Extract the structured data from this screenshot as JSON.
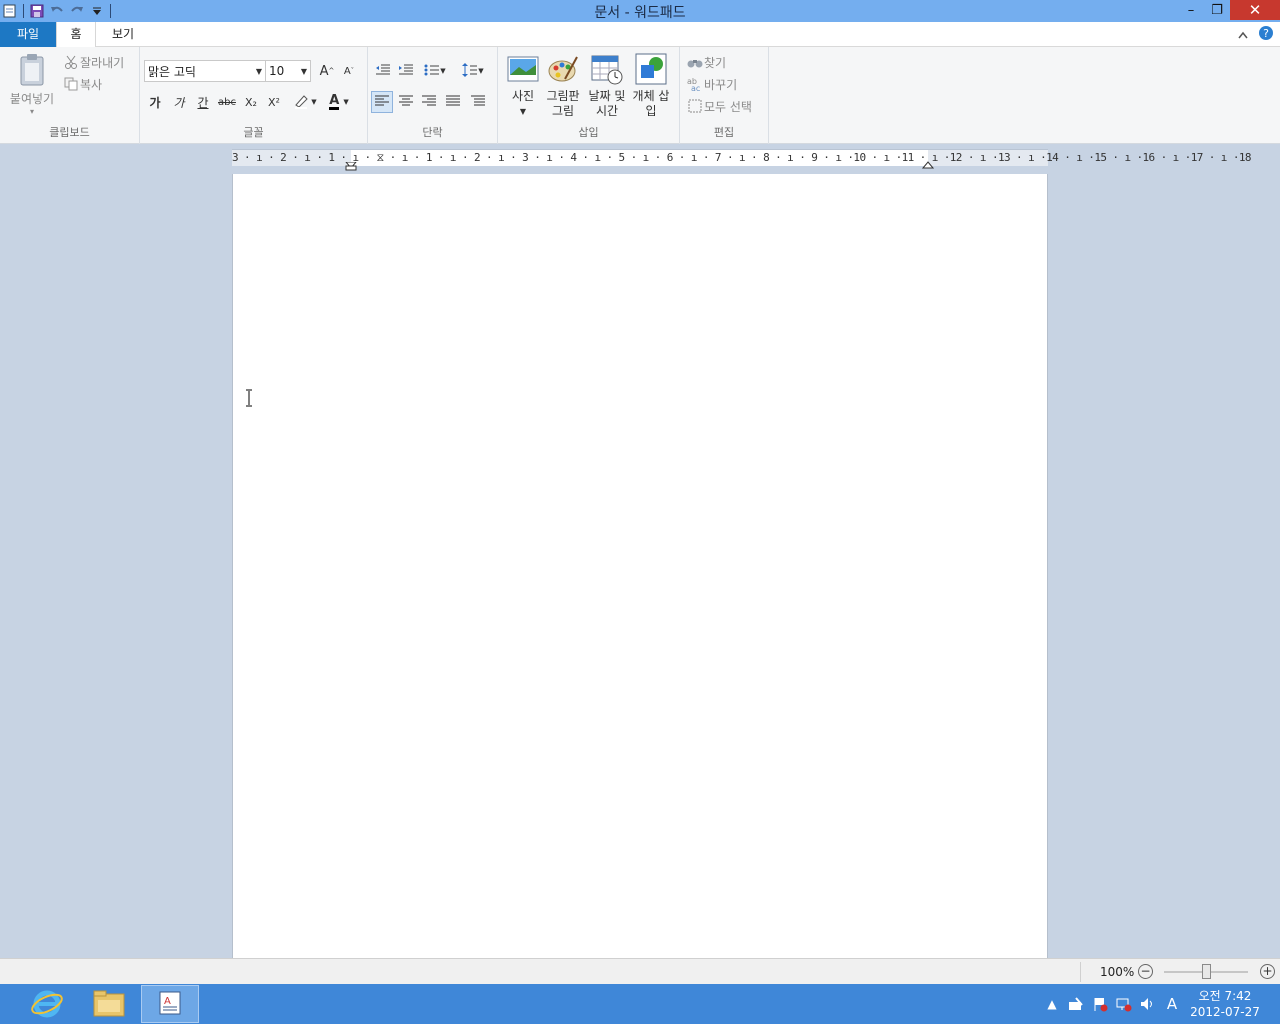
{
  "window": {
    "title": "문서 - 워드패드",
    "minimize": "–",
    "restore": "❐",
    "close": "✕"
  },
  "tabs": {
    "file": "파일",
    "home": "홈",
    "view": "보기"
  },
  "clipboard": {
    "paste": "붙여넣기",
    "cut": "잘라내기",
    "copy": "복사",
    "label": "클립보드"
  },
  "font": {
    "family": "맑은 고딕",
    "size": "10",
    "bold": "가",
    "italic": "가",
    "underline": "간",
    "strike": "abc",
    "subscript": "X₂",
    "superscript": "X²",
    "color_letter": "A",
    "grow": "A",
    "shrink": "A",
    "label": "글꼴"
  },
  "paragraph": {
    "label": "단락"
  },
  "insert": {
    "picture": "사진",
    "paint": "그림판 그림",
    "datetime": "날짜 및 시간",
    "object": "개체 삽입",
    "label": "삽입"
  },
  "editing": {
    "find": "찾기",
    "replace": "바꾸기",
    "select_all": "모두 선택",
    "label": "편집"
  },
  "ruler": {
    "text": "3 · ı · 2 · ı · 1 · ı · ⧖ · ı · 1 · ı · 2 · ı · 3 · ı · 4 · ı · 5 · ı · 6 · ı · 7 · ı · 8 · ı · 9 · ı ·10 · ı ·11 · ı ·12 · ı ·13 · ı ·14 · ı ·15 · ı ·16 · ı ·17 · ı ·18"
  },
  "status": {
    "zoom": "100%",
    "zoom_fraction": 0.5
  },
  "taskbar": {
    "ime": "A",
    "time": "오전 7:42",
    "date": "2012-07-27"
  },
  "colors": {
    "titlebar": "#74aeef",
    "file_tab": "#1d78c4",
    "taskbar": "#3f87d8",
    "close": "#c7382e"
  }
}
